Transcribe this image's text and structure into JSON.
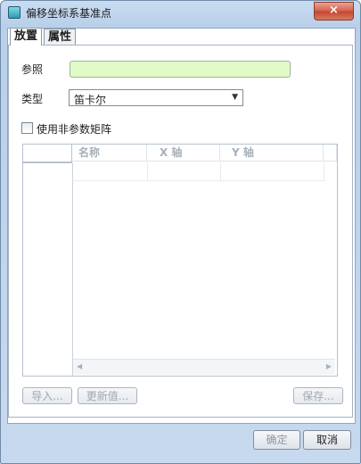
{
  "window": {
    "title": "偏移坐标系基准点",
    "close_label": "×"
  },
  "tabs": [
    {
      "label": "放置"
    },
    {
      "label": "属性"
    }
  ],
  "placement": {
    "reference_label": "参照",
    "reference_value": "",
    "type_label": "类型",
    "type_value": "笛卡尔",
    "nonparametric_label": "使用非参数矩阵",
    "nonparametric_checked": false
  },
  "table": {
    "columns": [
      "名称",
      "X 轴",
      "Y 轴"
    ],
    "rows": []
  },
  "buttons": {
    "import": "导入...",
    "update": "更新值...",
    "save": "保存..."
  },
  "footer": {
    "ok": "确定",
    "cancel": "取消"
  }
}
